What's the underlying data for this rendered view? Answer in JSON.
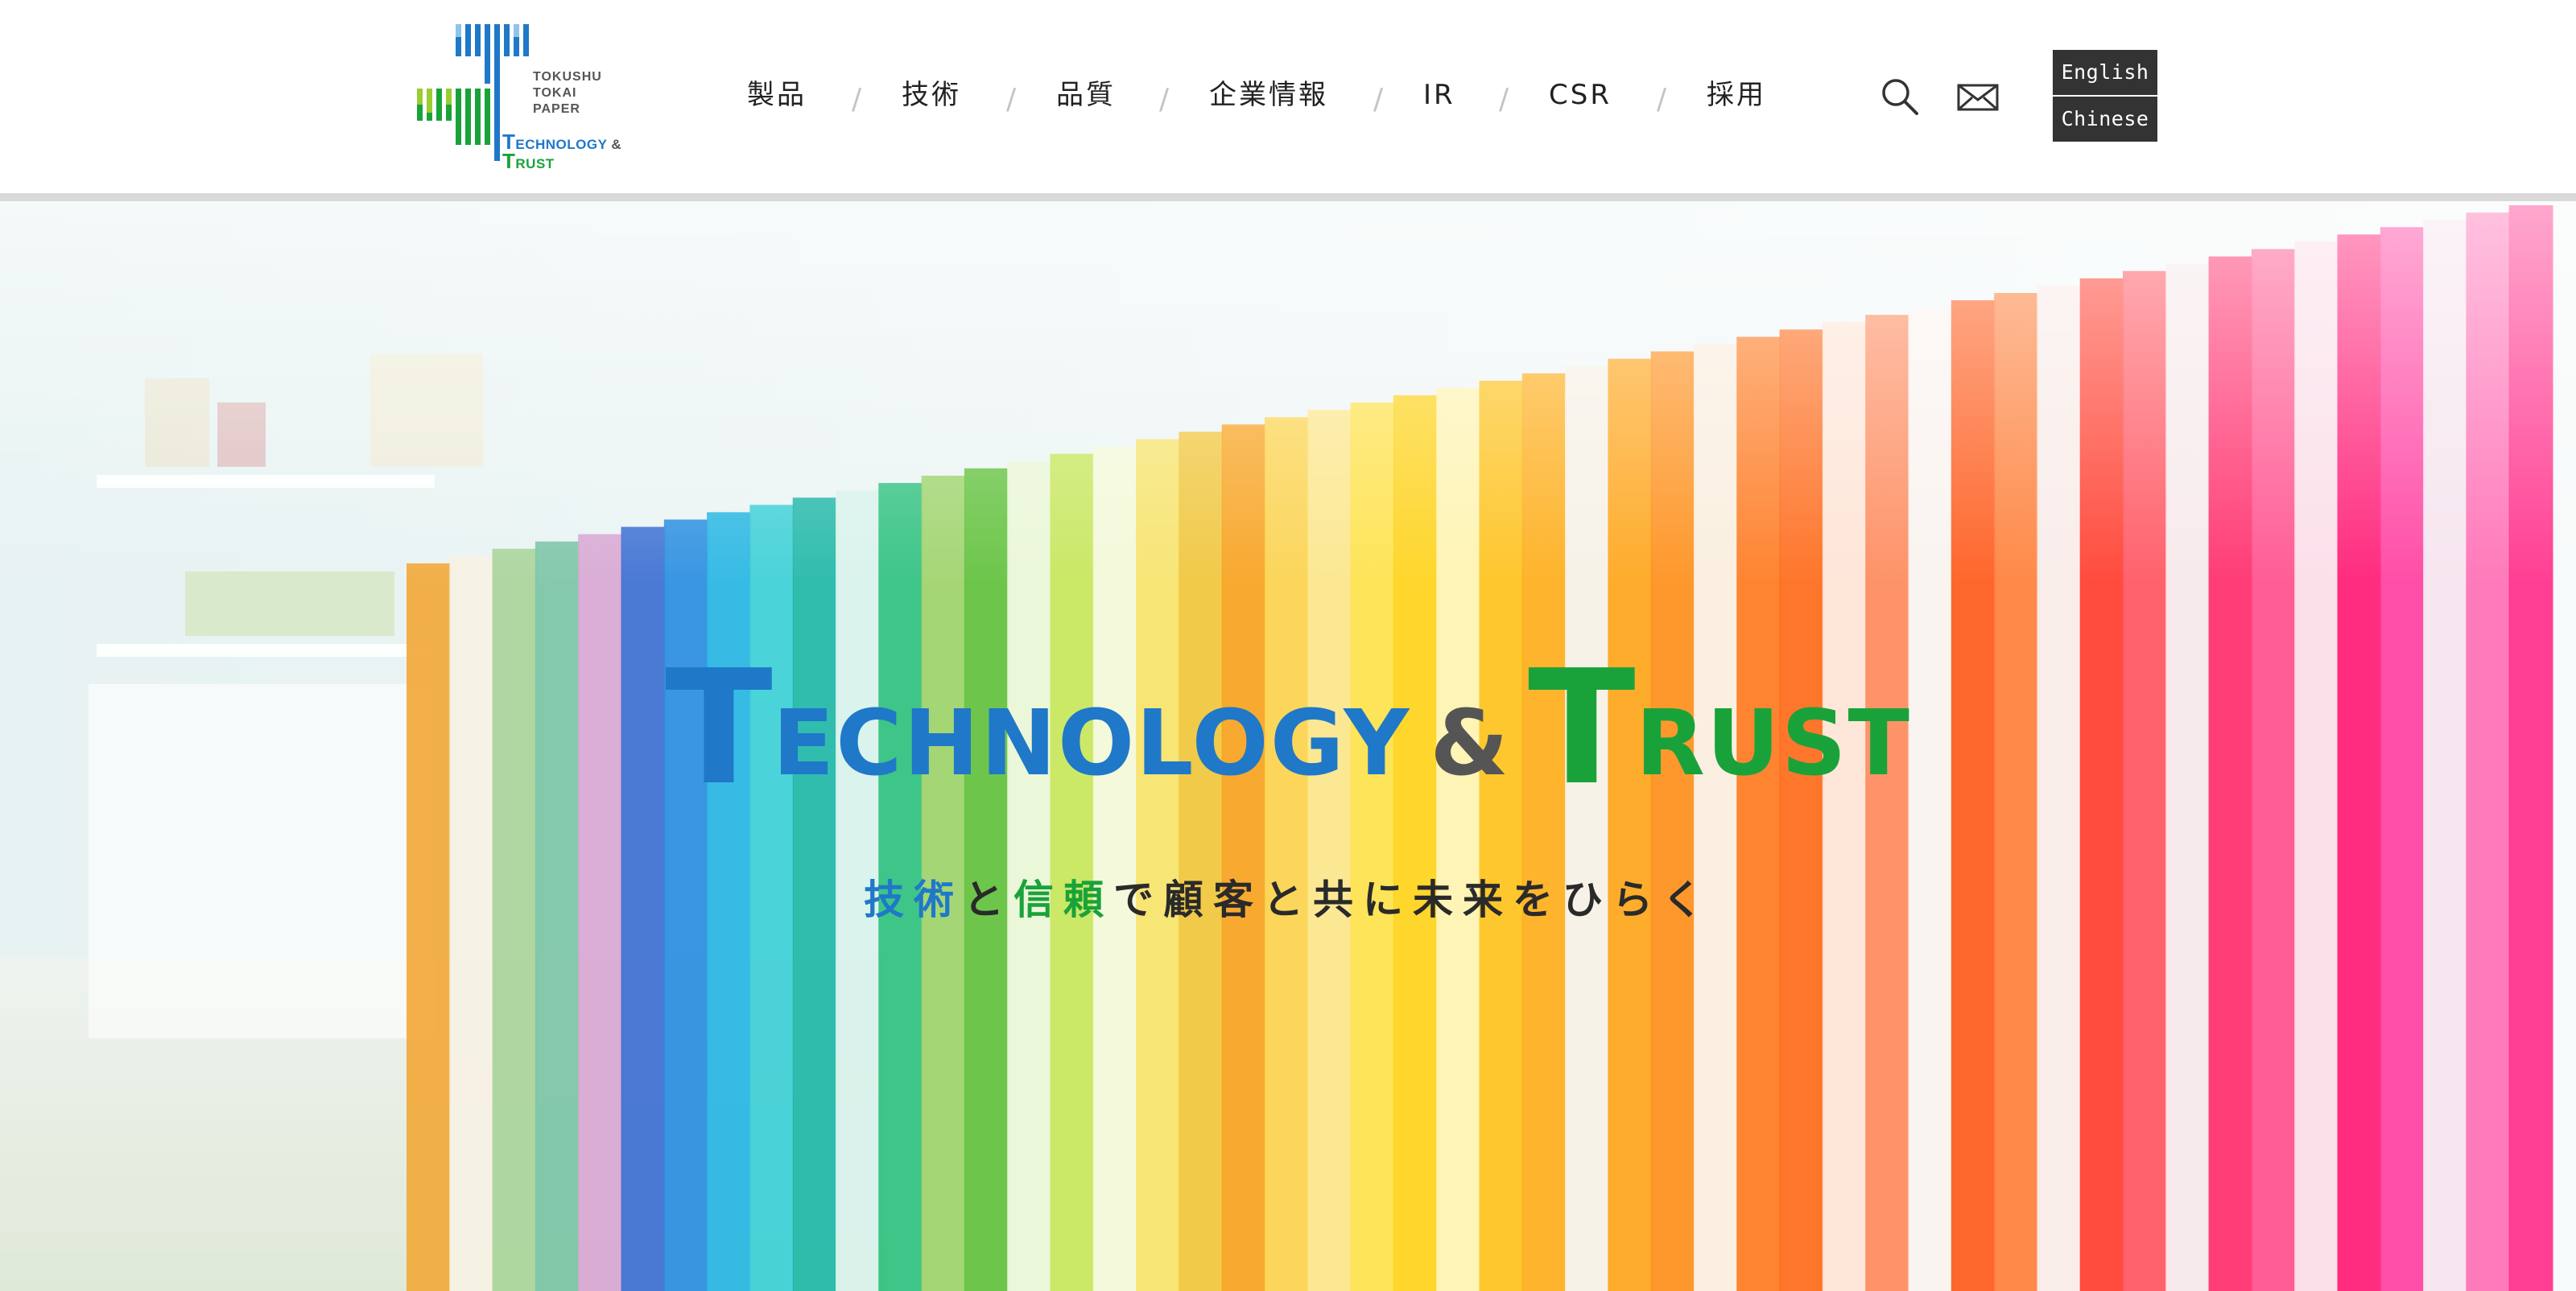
{
  "logo": {
    "company_lines": [
      "TOKUSHU",
      "TOKAI",
      "PAPER"
    ],
    "tagline_first": "T",
    "tagline_rest": "ECHNOLOGY",
    "tagline_amp": "&",
    "tagline2_first": "T",
    "tagline2_rest": "RUST"
  },
  "nav": {
    "items": [
      {
        "label": "製品"
      },
      {
        "label": "技術"
      },
      {
        "label": "品質"
      },
      {
        "label": "企業情報"
      },
      {
        "label": "IR"
      },
      {
        "label": "CSR"
      },
      {
        "label": "採用"
      }
    ],
    "separator": "/"
  },
  "utility": {
    "search_icon": "search-icon",
    "mail_icon": "mail-icon"
  },
  "language": {
    "english": "English",
    "chinese": "Chinese"
  },
  "hero": {
    "title_part1_first": "T",
    "title_part1_rest": "ECHNOLOGY",
    "title_amp": "&",
    "title_part2_first": "T",
    "title_part2_rest": "RUST",
    "subtitle_blue": "技術",
    "subtitle_and1": "と",
    "subtitle_green": "信頼",
    "subtitle_rest": "で顧客と共に未来をひらく"
  },
  "colors": {
    "blue": "#1f78c8",
    "green": "#1aa23a",
    "dark": "#333333",
    "amp_gray": "#555555"
  }
}
